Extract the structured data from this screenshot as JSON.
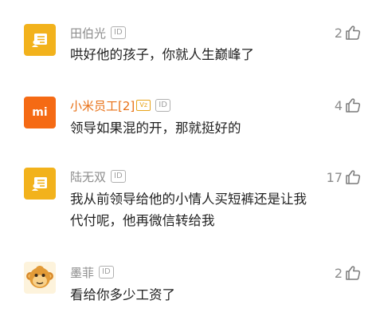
{
  "comments": [
    {
      "username": "田伯光",
      "id_badge": "ID",
      "text": "哄好他的孩子，你就人生巅峰了",
      "likes": "2",
      "avatar_icon": "document-icon",
      "name_color": "#8c8c8c"
    },
    {
      "username": "小米员工[2]",
      "vip_badge": "Vz",
      "id_badge": "ID",
      "text": "领导如果混的开，那就挺好的",
      "likes": "4",
      "avatar_icon": "xiaomi-logo",
      "avatar_text": "mi",
      "name_color": "#e87016"
    },
    {
      "username": "陆无双",
      "id_badge": "ID",
      "text": "我从前领导给他的小情人买短裤还是让我代付呢，他再微信转给我",
      "likes": "17",
      "avatar_icon": "document-icon",
      "name_color": "#8c8c8c"
    },
    {
      "username": "墨菲",
      "id_badge": "ID",
      "text": "看给你多少工资了",
      "likes": "2",
      "avatar_icon": "monkey-icon",
      "name_color": "#8c8c8c"
    }
  ]
}
